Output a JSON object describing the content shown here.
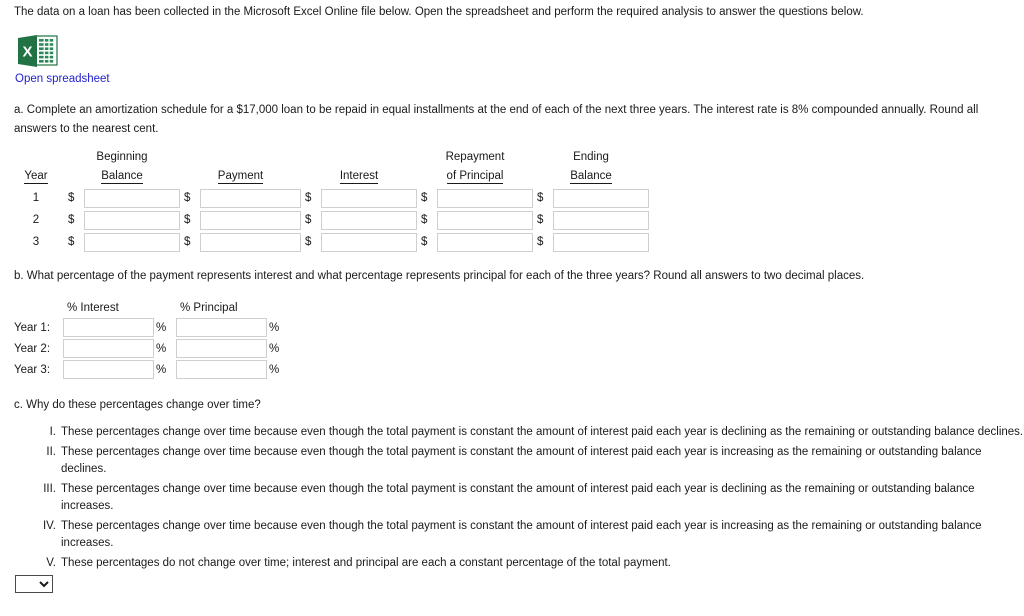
{
  "intro": {
    "text": "The data on a loan has been collected in the Microsoft Excel Online file below. Open the spreadsheet and perform the required analysis to answer the questions below."
  },
  "spreadsheet": {
    "icon_name": "excel-file-icon",
    "icon_letter": "X",
    "link_label": "Open spreadsheet",
    "link_color": "#2222cc",
    "icon_color": "#217346"
  },
  "question_a": {
    "text": "a. Complete an amortization schedule for a $17,000 loan to be repaid in equal installments at the end of each of the next three years. The interest rate is 8% compounded annually. Round all answers to the nearest cent.",
    "loan_amount": "$17,000",
    "interest_rate": "8%",
    "years": 3
  },
  "amortization_table": {
    "header_top": [
      "",
      "Beginning",
      "",
      "",
      "Repayment",
      "Ending"
    ],
    "header_bottom": [
      "Year",
      "Balance",
      "Payment",
      "Interest",
      "of Principal",
      "Balance"
    ],
    "currency_symbol": "$",
    "rows": [
      {
        "year": "1",
        "beginning_balance": "",
        "payment": "",
        "interest": "",
        "repayment_of_principal": "",
        "ending_balance": ""
      },
      {
        "year": "2",
        "beginning_balance": "",
        "payment": "",
        "interest": "",
        "repayment_of_principal": "",
        "ending_balance": ""
      },
      {
        "year": "3",
        "beginning_balance": "",
        "payment": "",
        "interest": "",
        "repayment_of_principal": "",
        "ending_balance": ""
      }
    ]
  },
  "question_b": {
    "text": "b. What percentage of the payment represents interest and what percentage represents principal for each of the three years? Round all answers to two decimal places."
  },
  "percent_table": {
    "header_interest": "% Interest",
    "header_principal": "% Principal",
    "percent_symbol": "%",
    "rows": [
      {
        "label": "Year 1:",
        "interest": "",
        "principal": ""
      },
      {
        "label": "Year 2:",
        "interest": "",
        "principal": ""
      },
      {
        "label": "Year 3:",
        "interest": "",
        "principal": ""
      }
    ]
  },
  "question_c": {
    "text": "c. Why do these percentages change over time?",
    "options": [
      {
        "numeral": "I.",
        "text": "These percentages change over time because even though the total payment is constant the amount of interest paid each year is declining as the remaining or outstanding balance declines."
      },
      {
        "numeral": "II.",
        "text": "These percentages change over time because even though the total payment is constant the amount of interest paid each year is increasing as the remaining or outstanding balance declines."
      },
      {
        "numeral": "III.",
        "text": "These percentages change over time because even though the total payment is constant the amount of interest paid each year is declining as the remaining or outstanding balance increases."
      },
      {
        "numeral": "IV.",
        "text": "These percentages change over time because even though the total payment is constant the amount of interest paid each year is increasing as the remaining or outstanding balance increases."
      },
      {
        "numeral": "V.",
        "text": "These percentages do not change over time; interest and principal are each a constant percentage of the total payment."
      }
    ]
  },
  "answer_select": {
    "name": "answer-dropdown",
    "selected": "",
    "options": [
      "",
      "I",
      "II",
      "III",
      "IV",
      "V"
    ]
  }
}
